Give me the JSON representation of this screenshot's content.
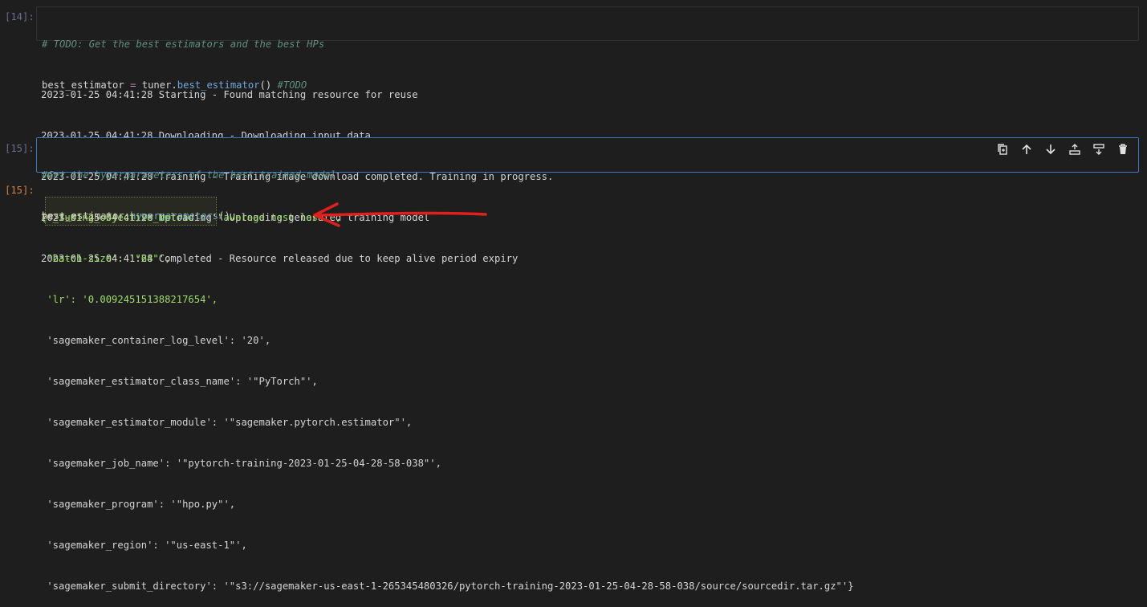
{
  "cells": {
    "c14": {
      "prompt": "[14]:",
      "line1": "# TODO: Get the best estimators and the best HPs",
      "line2_var": "best_estimator",
      "line2_op": " = ",
      "line2_obj": "tuner.",
      "line2_fn": "best_estimator",
      "line2_call": "() ",
      "line2_comment": "#TODO"
    },
    "stream": [
      "2023-01-25 04:41:28 Starting - Found matching resource for reuse",
      "2023-01-25 04:41:28 Downloading - Downloading input data",
      "2023-01-25 04:41:28 Training - Training image download completed. Training in progress.",
      "2023-01-25 04:41:28 Uploading - Uploading generated training model",
      "2023-01-25 04:41:28 Completed - Resource released due to keep alive period expiry"
    ],
    "c15": {
      "prompt": "[15]:",
      "line1": "#Get the hyperparameters of the best trained model",
      "line2_obj": "best_estimator.",
      "line2_fn": "hyperparameters",
      "line2_call": "()"
    },
    "out15": {
      "prompt": "[15]:",
      "lines": [
        "{'_tuning_objective_metric': '\"average test loss\"',",
        " 'batch-size': '\"64\"',",
        " 'lr': '0.009245151388217654',",
        " 'sagemaker_container_log_level': '20',",
        " 'sagemaker_estimator_class_name': '\"PyTorch\"',",
        " 'sagemaker_estimator_module': '\"sagemaker.pytorch.estimator\"',",
        " 'sagemaker_job_name': '\"pytorch-training-2023-01-25-04-28-58-038\"',",
        " 'sagemaker_program': '\"hpo.py\"',",
        " 'sagemaker_region': '\"us-east-1\"',",
        " 'sagemaker_submit_directory': '\"s3://sagemaker-us-east-1-265345480326/pytorch-training-2023-01-25-04-28-58-038/source/sourcedir.tar.gz\"'}"
      ]
    }
  },
  "toolbar_icons": [
    "duplicate-icon",
    "move-up-icon",
    "move-down-icon",
    "insert-above-icon",
    "insert-below-icon",
    "delete-icon"
  ],
  "colors": {
    "selected_border": "#3b78c0",
    "arrow": "#e0201c",
    "highlight_text": "#9fdc6a"
  }
}
